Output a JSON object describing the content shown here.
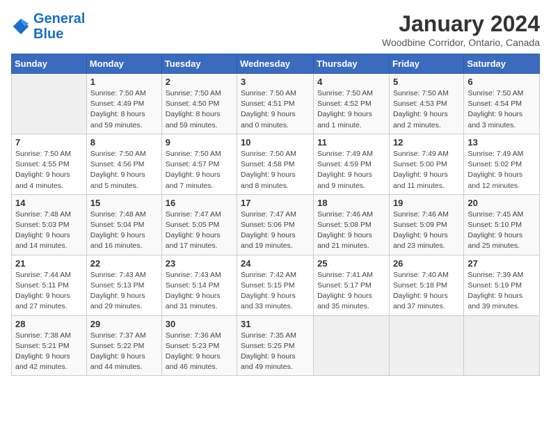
{
  "header": {
    "logo_line1": "General",
    "logo_line2": "Blue",
    "title": "January 2024",
    "subtitle": "Woodbine Corridor, Ontario, Canada"
  },
  "weekdays": [
    "Sunday",
    "Monday",
    "Tuesday",
    "Wednesday",
    "Thursday",
    "Friday",
    "Saturday"
  ],
  "weeks": [
    [
      {
        "day": "",
        "info": ""
      },
      {
        "day": "1",
        "info": "Sunrise: 7:50 AM\nSunset: 4:49 PM\nDaylight: 8 hours\nand 59 minutes."
      },
      {
        "day": "2",
        "info": "Sunrise: 7:50 AM\nSunset: 4:50 PM\nDaylight: 8 hours\nand 59 minutes."
      },
      {
        "day": "3",
        "info": "Sunrise: 7:50 AM\nSunset: 4:51 PM\nDaylight: 9 hours\nand 0 minutes."
      },
      {
        "day": "4",
        "info": "Sunrise: 7:50 AM\nSunset: 4:52 PM\nDaylight: 9 hours\nand 1 minute."
      },
      {
        "day": "5",
        "info": "Sunrise: 7:50 AM\nSunset: 4:53 PM\nDaylight: 9 hours\nand 2 minutes."
      },
      {
        "day": "6",
        "info": "Sunrise: 7:50 AM\nSunset: 4:54 PM\nDaylight: 9 hours\nand 3 minutes."
      }
    ],
    [
      {
        "day": "7",
        "info": "Sunrise: 7:50 AM\nSunset: 4:55 PM\nDaylight: 9 hours\nand 4 minutes."
      },
      {
        "day": "8",
        "info": "Sunrise: 7:50 AM\nSunset: 4:56 PM\nDaylight: 9 hours\nand 5 minutes."
      },
      {
        "day": "9",
        "info": "Sunrise: 7:50 AM\nSunset: 4:57 PM\nDaylight: 9 hours\nand 7 minutes."
      },
      {
        "day": "10",
        "info": "Sunrise: 7:50 AM\nSunset: 4:58 PM\nDaylight: 9 hours\nand 8 minutes."
      },
      {
        "day": "11",
        "info": "Sunrise: 7:49 AM\nSunset: 4:59 PM\nDaylight: 9 hours\nand 9 minutes."
      },
      {
        "day": "12",
        "info": "Sunrise: 7:49 AM\nSunset: 5:00 PM\nDaylight: 9 hours\nand 11 minutes."
      },
      {
        "day": "13",
        "info": "Sunrise: 7:49 AM\nSunset: 5:02 PM\nDaylight: 9 hours\nand 12 minutes."
      }
    ],
    [
      {
        "day": "14",
        "info": "Sunrise: 7:48 AM\nSunset: 5:03 PM\nDaylight: 9 hours\nand 14 minutes."
      },
      {
        "day": "15",
        "info": "Sunrise: 7:48 AM\nSunset: 5:04 PM\nDaylight: 9 hours\nand 16 minutes."
      },
      {
        "day": "16",
        "info": "Sunrise: 7:47 AM\nSunset: 5:05 PM\nDaylight: 9 hours\nand 17 minutes."
      },
      {
        "day": "17",
        "info": "Sunrise: 7:47 AM\nSunset: 5:06 PM\nDaylight: 9 hours\nand 19 minutes."
      },
      {
        "day": "18",
        "info": "Sunrise: 7:46 AM\nSunset: 5:08 PM\nDaylight: 9 hours\nand 21 minutes."
      },
      {
        "day": "19",
        "info": "Sunrise: 7:46 AM\nSunset: 5:09 PM\nDaylight: 9 hours\nand 23 minutes."
      },
      {
        "day": "20",
        "info": "Sunrise: 7:45 AM\nSunset: 5:10 PM\nDaylight: 9 hours\nand 25 minutes."
      }
    ],
    [
      {
        "day": "21",
        "info": "Sunrise: 7:44 AM\nSunset: 5:11 PM\nDaylight: 9 hours\nand 27 minutes."
      },
      {
        "day": "22",
        "info": "Sunrise: 7:43 AM\nSunset: 5:13 PM\nDaylight: 9 hours\nand 29 minutes."
      },
      {
        "day": "23",
        "info": "Sunrise: 7:43 AM\nSunset: 5:14 PM\nDaylight: 9 hours\nand 31 minutes."
      },
      {
        "day": "24",
        "info": "Sunrise: 7:42 AM\nSunset: 5:15 PM\nDaylight: 9 hours\nand 33 minutes."
      },
      {
        "day": "25",
        "info": "Sunrise: 7:41 AM\nSunset: 5:17 PM\nDaylight: 9 hours\nand 35 minutes."
      },
      {
        "day": "26",
        "info": "Sunrise: 7:40 AM\nSunset: 5:18 PM\nDaylight: 9 hours\nand 37 minutes."
      },
      {
        "day": "27",
        "info": "Sunrise: 7:39 AM\nSunset: 5:19 PM\nDaylight: 9 hours\nand 39 minutes."
      }
    ],
    [
      {
        "day": "28",
        "info": "Sunrise: 7:38 AM\nSunset: 5:21 PM\nDaylight: 9 hours\nand 42 minutes."
      },
      {
        "day": "29",
        "info": "Sunrise: 7:37 AM\nSunset: 5:22 PM\nDaylight: 9 hours\nand 44 minutes."
      },
      {
        "day": "30",
        "info": "Sunrise: 7:36 AM\nSunset: 5:23 PM\nDaylight: 9 hours\nand 46 minutes."
      },
      {
        "day": "31",
        "info": "Sunrise: 7:35 AM\nSunset: 5:25 PM\nDaylight: 9 hours\nand 49 minutes."
      },
      {
        "day": "",
        "info": ""
      },
      {
        "day": "",
        "info": ""
      },
      {
        "day": "",
        "info": ""
      }
    ]
  ]
}
